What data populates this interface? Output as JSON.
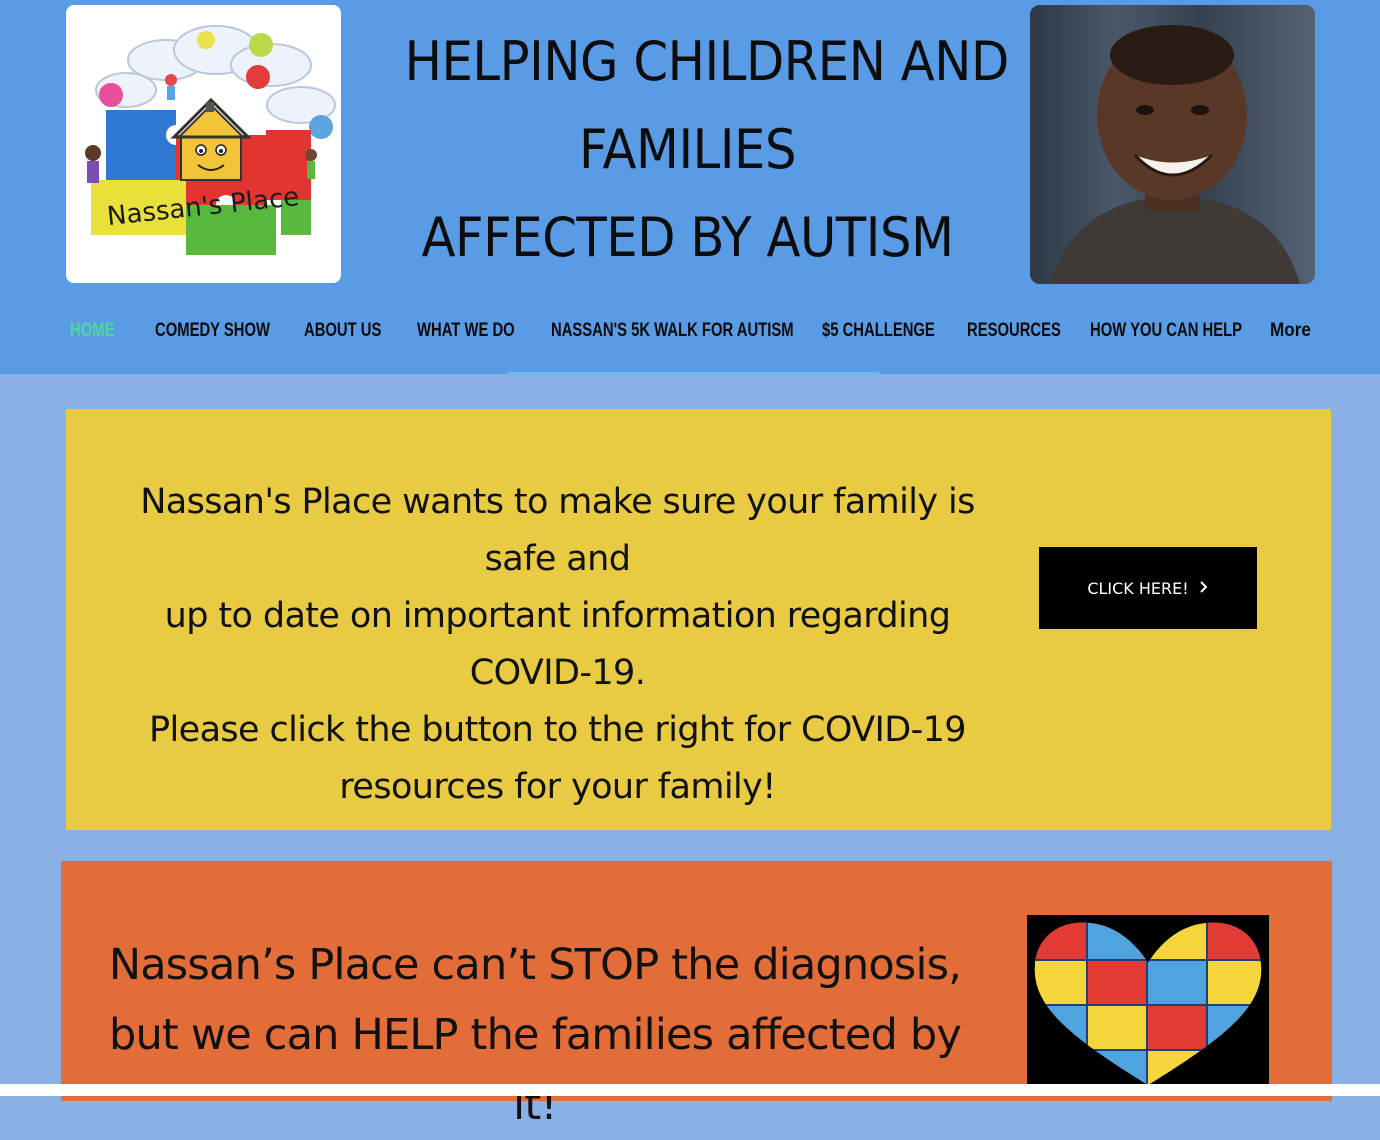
{
  "header": {
    "headline_line1": "HELPING CHILDREN AND",
    "headline_line2": "FAMILIES",
    "headline_line3": "AFFECTED BY AUTISM",
    "logo_text": "Nassan's Place"
  },
  "nav": {
    "items": [
      {
        "label": "HOME",
        "active": true
      },
      {
        "label": "COMEDY SHOW"
      },
      {
        "label": "ABOUT US"
      },
      {
        "label": "WHAT WE DO"
      },
      {
        "label": "NASSAN'S 5K WALK FOR AUTISM"
      },
      {
        "label": "$5 CHALLENGE"
      },
      {
        "label": "RESOURCES"
      },
      {
        "label": "HOW YOU CAN HELP"
      },
      {
        "label": "More"
      }
    ],
    "active_color": "#4fd69a"
  },
  "covid": {
    "line1": "Nassan's Place wants to make sure your family is safe and",
    "line2": "up to date on important information regarding COVID-19.",
    "line3": "Please click the button to the right for COVID-19",
    "line4": "resources for your family!",
    "button_label": "CLICK HERE!",
    "button_icon": "chevron-right-icon"
  },
  "mission": {
    "line1": "Nassan’s Place can’t STOP the diagnosis,",
    "line2": "but we can HELP the families affected by it!"
  },
  "colors": {
    "header_bg": "#5a9be6",
    "page_bg": "#8ab1e6",
    "yellow_panel": "#e9ca43",
    "orange_panel": "#e36d38"
  }
}
